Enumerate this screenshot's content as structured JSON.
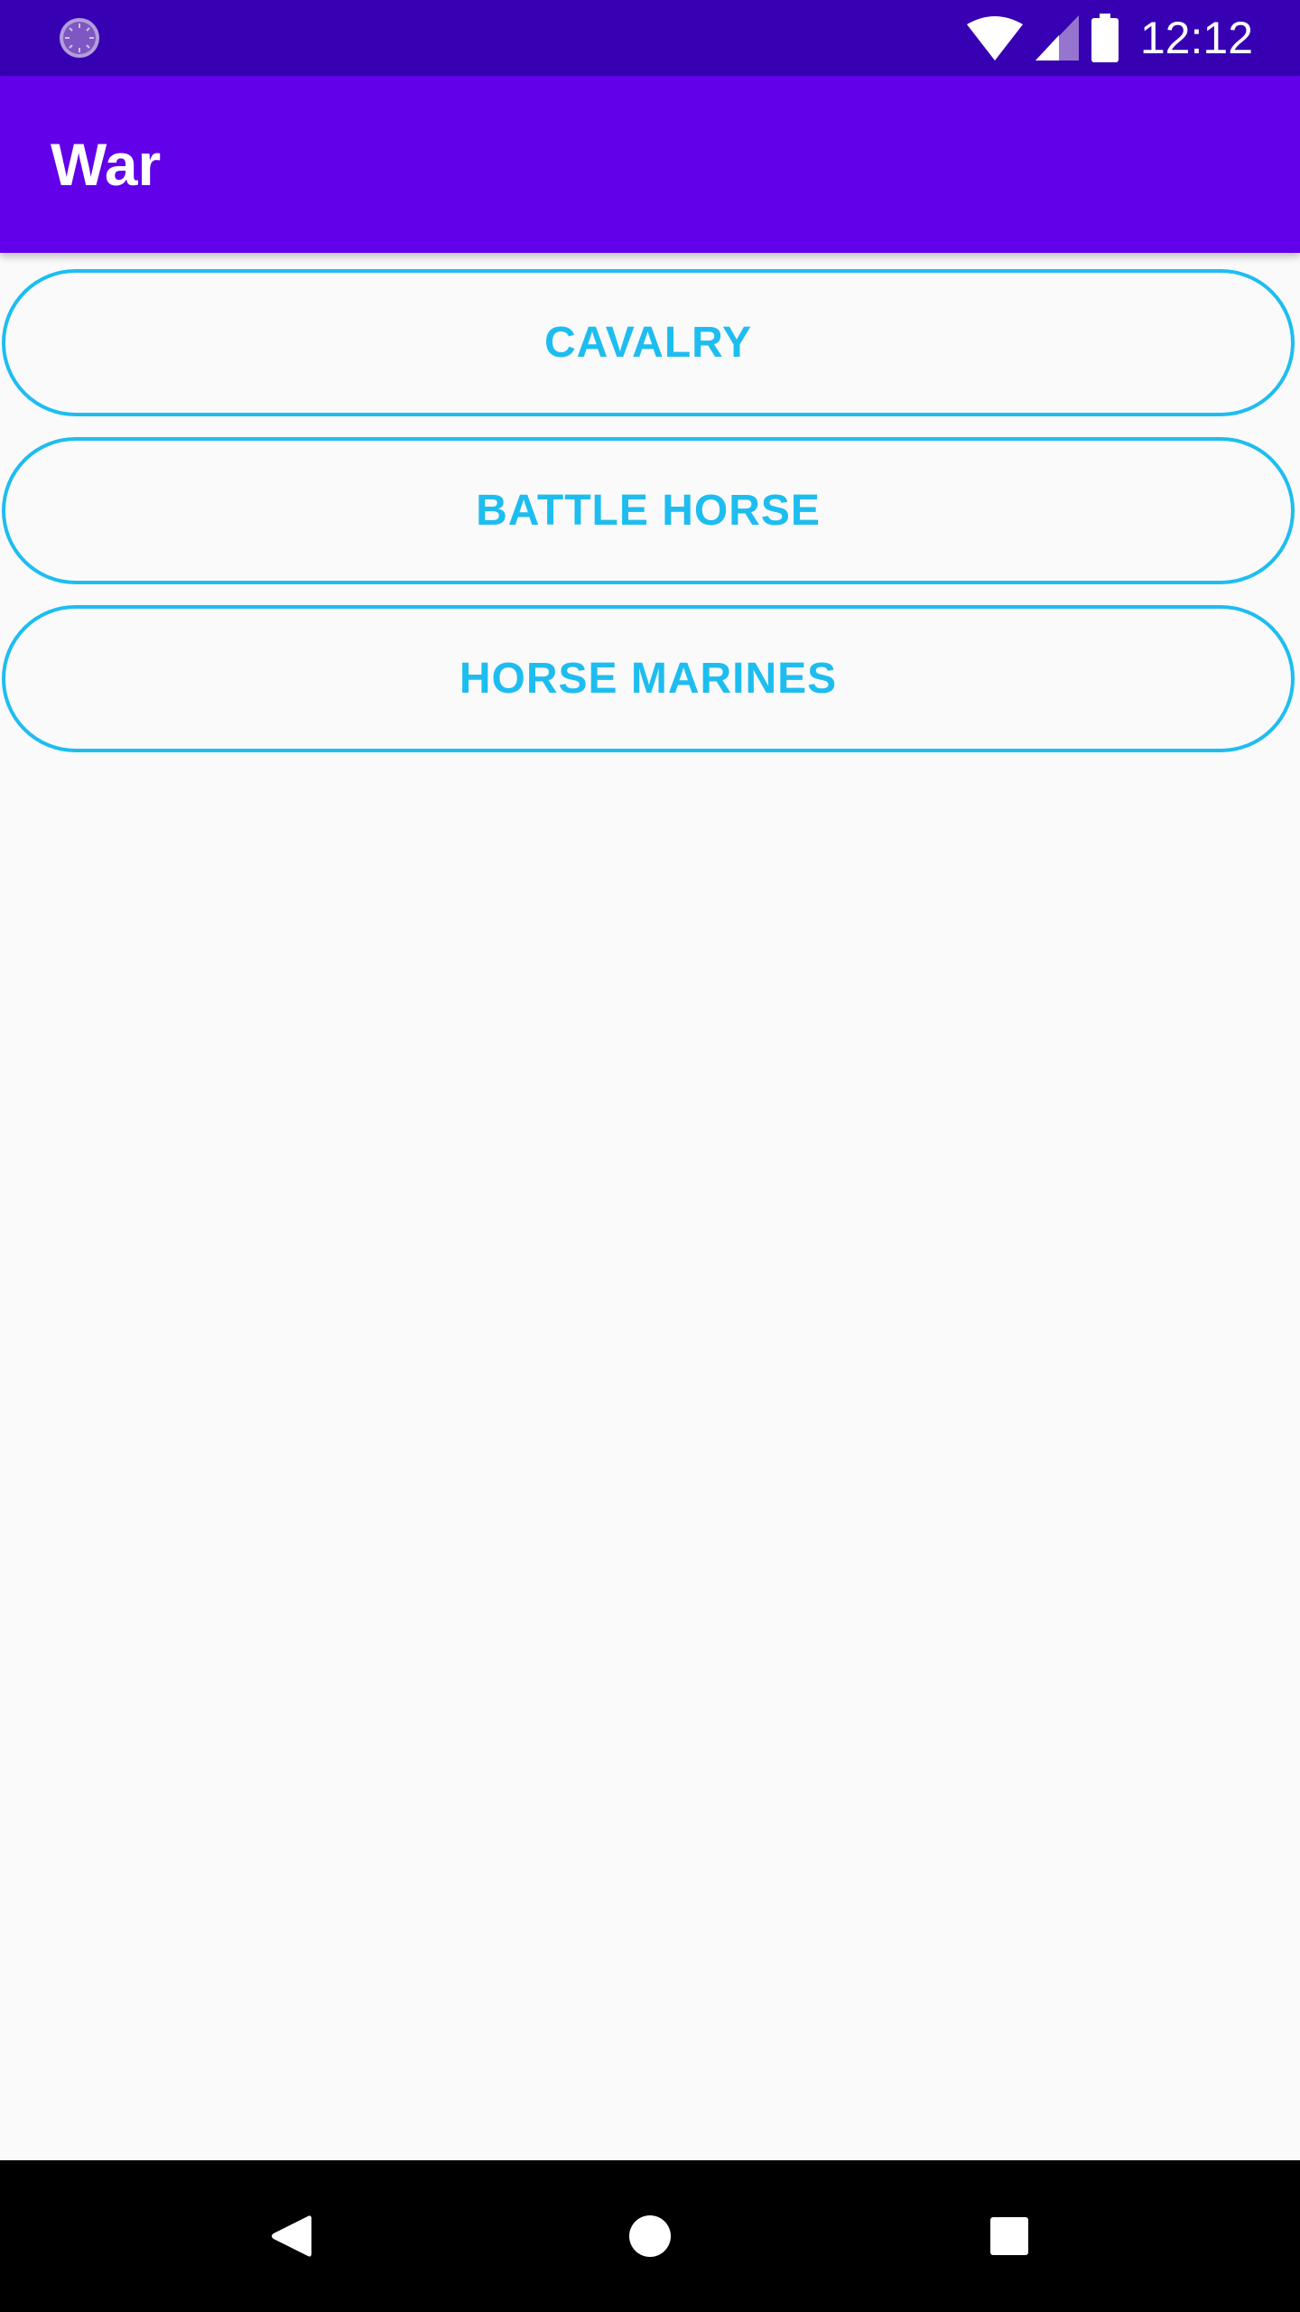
{
  "status_bar": {
    "time": "12:12",
    "icons": [
      "app-loading-icon",
      "wifi-icon",
      "cellular-signal-icon",
      "battery-icon"
    ],
    "background": "#3700b3"
  },
  "app_bar": {
    "title": "War",
    "background": "#6200ea"
  },
  "buttons": [
    {
      "label": "CAVALRY"
    },
    {
      "label": "BATTLE HORSE"
    },
    {
      "label": "HORSE MARINES"
    }
  ],
  "colors": {
    "accent": "#1ebdf0",
    "background": "#fafafa"
  },
  "nav_bar": {
    "icons": [
      "back-icon",
      "home-icon",
      "recents-icon"
    ]
  }
}
